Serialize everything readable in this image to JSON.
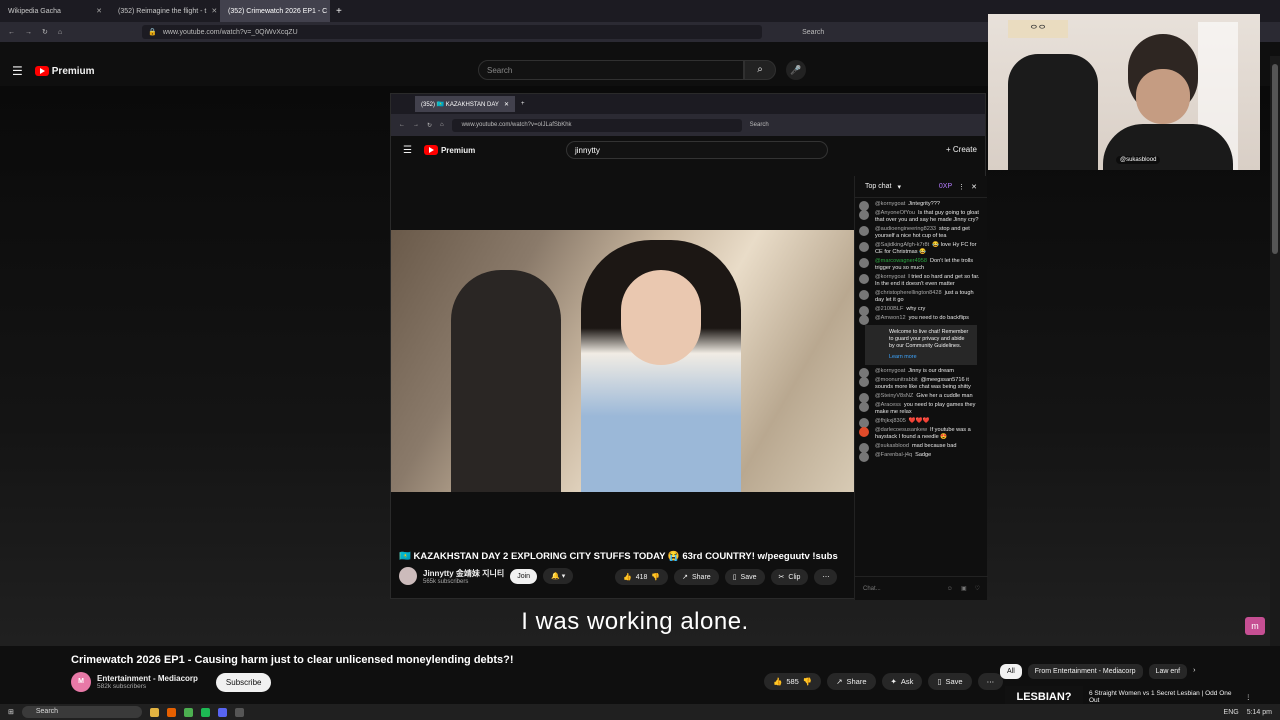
{
  "browser": {
    "tabs": [
      {
        "label": "Wikipedia Gacha"
      },
      {
        "label": "(352) Reimagine the flight - t"
      },
      {
        "label": "(352) Crimewatch 2026 EP1 - C"
      }
    ],
    "url": "www.youtube.com/watch?v=_0QiWvXcqZU",
    "search_placeholder": "Search"
  },
  "youtube": {
    "logo": "Premium",
    "search_placeholder": "Search"
  },
  "subtitle": "I was working alone.",
  "inner_browser": {
    "tab_label": "(352) 🇰🇿 KAZAKHSTAN DAY",
    "url": "www.youtube.com/watch?v=oIJLafSbKhk",
    "search_placeholder": "Search",
    "logo": "Premium",
    "search_value": "jinnytty",
    "create_label": "Create",
    "video_title": "🇰🇿 KAZAKHSTAN DAY 2 EXPLORING CITY STUFFS TODAY 😭 63rd COUNTRY! w/peeguutv !subs",
    "channel_name": "Jinnytty 金靖妹 지니티",
    "subscribers": "565k subscribers",
    "join_label": "Join",
    "like_count": "418",
    "share_label": "Share",
    "save_label": "Save",
    "clip_label": "Clip"
  },
  "chat": {
    "header": "Top chat",
    "xp": "0XP",
    "messages": [
      {
        "user": "@kornygoat",
        "text": "Jintegrity???"
      },
      {
        "user": "@AnyoneOfYou",
        "text": "Is that guy going to gloat that over you and say he made Jinny cry?"
      },
      {
        "user": "@audioengineering8233",
        "text": "stop and get yourself a nice hot cup of tea"
      },
      {
        "user": "@SajidkingAfgh-k7r8t",
        "text": "😂 love Hy FC for CE for Christmas 😂"
      },
      {
        "user": "@marcowagner4958",
        "text": "Don't let the trolls trigger you so much"
      },
      {
        "user": "@kornygoat",
        "text": "I tried so hard and get so far. In the end it doesn't even matter"
      },
      {
        "user": "@christopherellington8428",
        "text": "just a tough day let it go"
      },
      {
        "user": "@2100BLF",
        "text": "why cry"
      },
      {
        "user": "@Amwon12",
        "text": "you need to do backflips"
      }
    ],
    "welcome_text": "Welcome to live chat! Remember to guard your privacy and abide by our Community Guidelines.",
    "learn_more": "Learn more",
    "messages2": [
      {
        "user": "@kornygoat",
        "text": "Jinny is our dream"
      },
      {
        "user": "@moonunitrabbit",
        "text": "@meegssan5716 it sounds more like chat was being shitty"
      },
      {
        "user": "@SteinyV8sNZ",
        "text": "Give her a cuddle man"
      },
      {
        "user": "@Aracess",
        "text": "you need to play games they make me relax"
      },
      {
        "user": "@fhjkxj8305",
        "text": "❤️❤️❤️"
      },
      {
        "user": "@darlecoesusankew",
        "text": "If youtube was a haystack I found a needle 😍"
      },
      {
        "user": "@sukasblood",
        "text": "mad because bad"
      },
      {
        "user": "@Farenbal-j4q",
        "text": "Sadge"
      }
    ],
    "input_placeholder": "Chat..."
  },
  "webcam": {
    "tag": "@sukasblood"
  },
  "main_video": {
    "title": "Crimewatch 2026 EP1 - Causing harm just to clear unlicensed moneylending debts?!",
    "channel": "Entertainment - Mediacorp",
    "subscribers": "582k subscribers",
    "subscribe_label": "Subscribe",
    "like_count": "585",
    "share_label": "Share",
    "ask_label": "Ask",
    "save_label": "Save"
  },
  "chips": [
    {
      "label": "All"
    },
    {
      "label": "From Entertainment - Mediacorp"
    },
    {
      "label": "Law enf"
    }
  ],
  "recommendation": {
    "thumb_text": "LESBIAN?",
    "title": "6 Straight Women vs 1 Secret Lesbian | Odd One Out"
  },
  "taskbar": {
    "search": "Search",
    "lang": "ENG",
    "time": "5:14 pm"
  }
}
